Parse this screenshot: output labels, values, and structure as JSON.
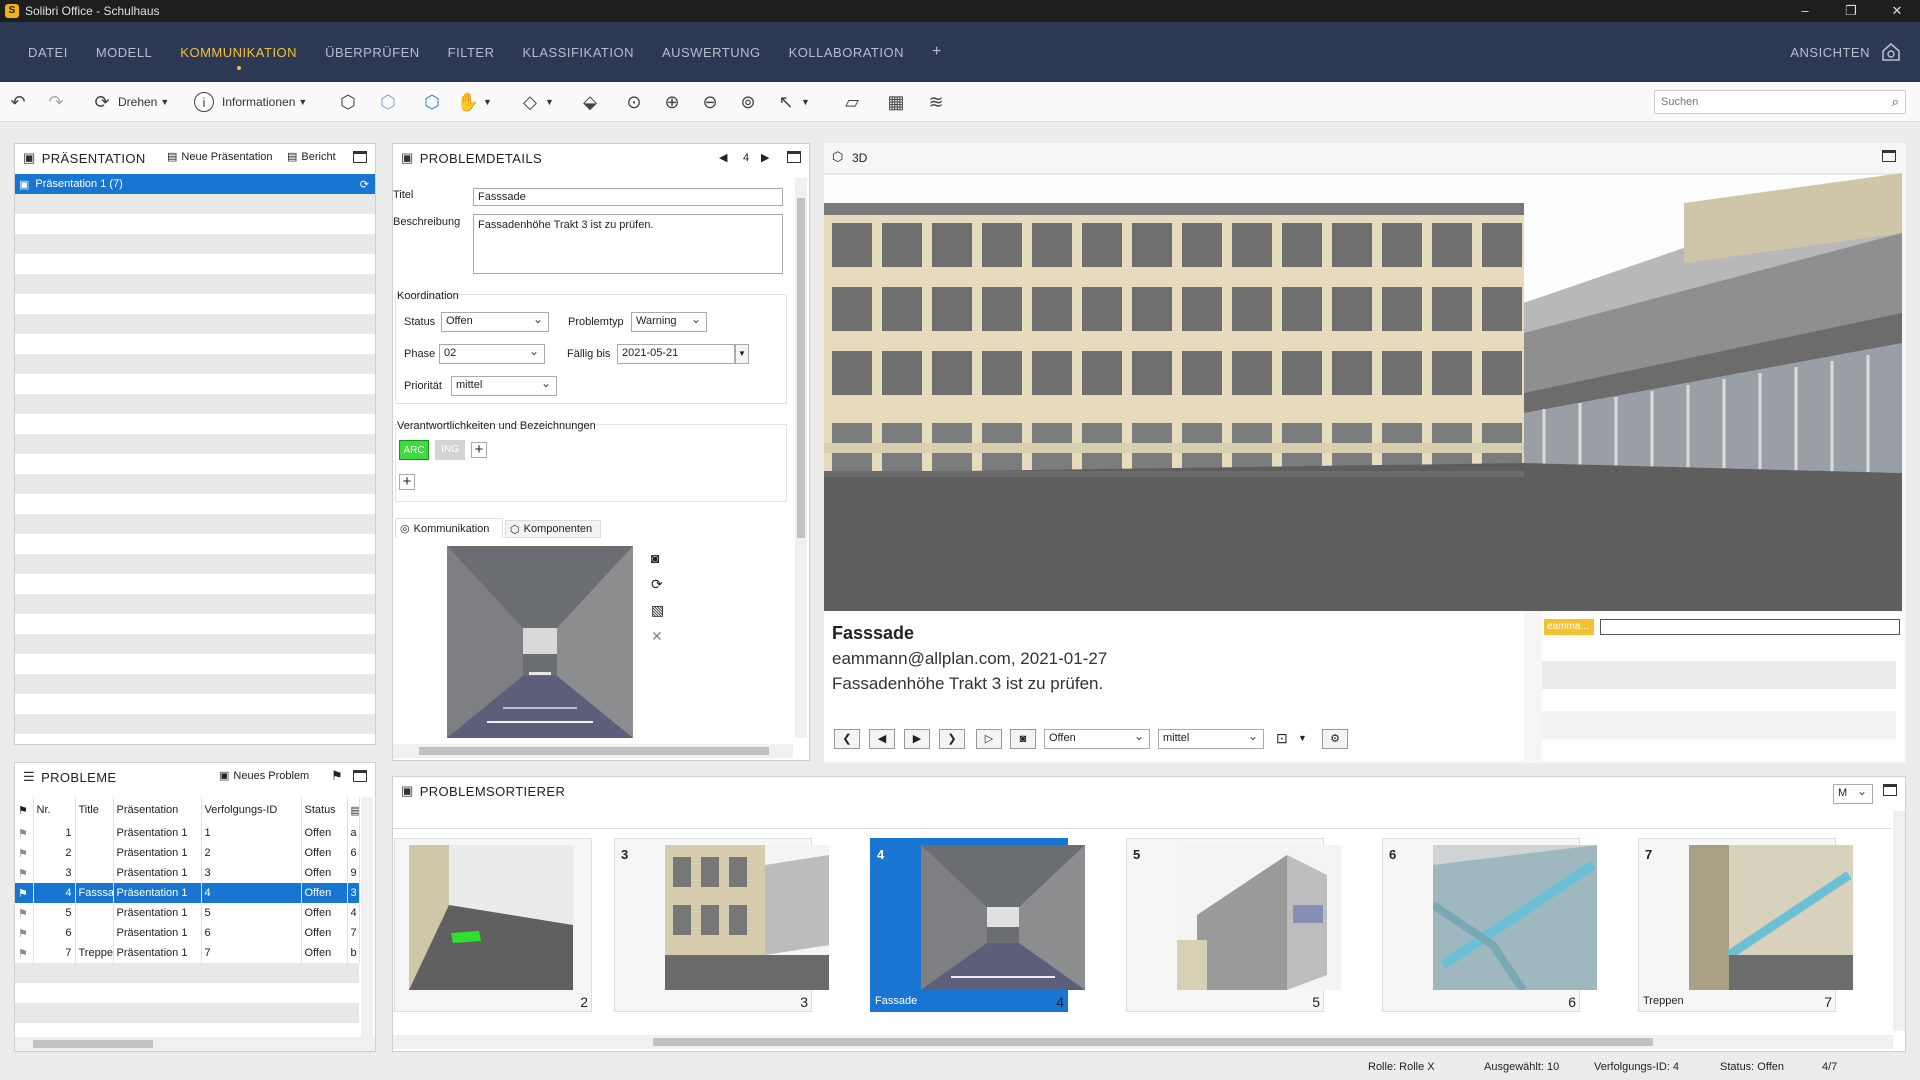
{
  "window": {
    "title": "Solibri Office - Schulhaus",
    "app_icon_letter": "S",
    "minimize": "–",
    "maximize": "❐",
    "close": "✕"
  },
  "menu": {
    "items": [
      "DATEI",
      "MODELL",
      "KOMMUNIKATION",
      "ÜBERPRÜFEN",
      "FILTER",
      "KLASSIFIKATION",
      "AUSWERTUNG",
      "KOLLABORATION",
      "+"
    ],
    "active_index": 2,
    "right_label": "ANSICHTEN"
  },
  "toolbar": {
    "rotate_label": "Drehen",
    "info_label": "Informationen",
    "search_placeholder": "Suchen"
  },
  "presentation_panel": {
    "title": "PRÄSENTATION",
    "new_label": "Neue Präsentation",
    "report_label": "Bericht",
    "selected_item": "Präsentation 1 (7)"
  },
  "details_panel": {
    "title": "PROBLEMDETAILS",
    "index": "4",
    "title_label": "Titel",
    "title_value": "Fasssade",
    "desc_label": "Beschreibung",
    "desc_value": "Fassadenhöhe Trakt 3 ist zu prüfen.",
    "coord_label": "Koordination",
    "status_label": "Status",
    "status_value": "Offen",
    "type_label": "Problemtyp",
    "type_value": "Warning",
    "phase_label": "Phase",
    "phase_value": "02",
    "due_label": "Fällig bis",
    "due_value": "2021-05-21",
    "priority_label": "Priorität",
    "priority_value": "mittel",
    "resp_label": "Verantwortlichkeiten und Bezeichnungen",
    "tag_arc": "ARC",
    "tag_ing": "ING",
    "tab_comm": "Kommunikation",
    "tab_comp": "Komponenten"
  },
  "view3d": {
    "title": "3D",
    "issue_title": "Fasssade",
    "issue_meta": "eammann@allplan.com, 2021-01-27",
    "issue_desc": "Fassadenhöhe Trakt 3 ist zu prüfen.",
    "status_select": "Offen",
    "priority_select": "mittel",
    "user_tag": "eamma..."
  },
  "problems_panel": {
    "title": "PROBLEME",
    "new_label": "Neues Problem",
    "columns": [
      "Nr.",
      "Title",
      "Präsentation",
      "Verfolgungs-ID",
      "Status"
    ],
    "rows": [
      {
        "nr": "1",
        "title": "",
        "pres": "Präsentation 1",
        "id": "1",
        "status": "Offen",
        "extra": "a"
      },
      {
        "nr": "2",
        "title": "",
        "pres": "Präsentation 1",
        "id": "2",
        "status": "Offen",
        "extra": "6"
      },
      {
        "nr": "3",
        "title": "",
        "pres": "Präsentation 1",
        "id": "3",
        "status": "Offen",
        "extra": "9"
      },
      {
        "nr": "4",
        "title": "Fasssad",
        "pres": "Präsentation 1",
        "id": "4",
        "status": "Offen",
        "extra": "3"
      },
      {
        "nr": "5",
        "title": "",
        "pres": "Präsentation 1",
        "id": "5",
        "status": "Offen",
        "extra": "4"
      },
      {
        "nr": "6",
        "title": "",
        "pres": "Präsentation 1",
        "id": "6",
        "status": "Offen",
        "extra": "7"
      },
      {
        "nr": "7",
        "title": "Treppe",
        "pres": "Präsentation 1",
        "id": "7",
        "status": "Offen",
        "extra": "b"
      }
    ],
    "selected_row": 3
  },
  "sorter_panel": {
    "title": "PROBLEMSORTIERER",
    "size_select": "M",
    "thumbs": [
      {
        "num": "",
        "inum": "2",
        "caption": ""
      },
      {
        "num": "3",
        "inum": "3",
        "caption": ""
      },
      {
        "num": "4",
        "inum": "4",
        "caption": "Fassade"
      },
      {
        "num": "5",
        "inum": "5",
        "caption": ""
      },
      {
        "num": "6",
        "inum": "6",
        "caption": ""
      },
      {
        "num": "7",
        "inum": "7",
        "caption": "Treppen"
      }
    ]
  },
  "statusbar": {
    "role": "Rolle: Rolle X",
    "selected": "Ausgewählt: 10",
    "tracking": "Verfolgungs-ID: 4",
    "status": "Status: Offen",
    "page": "4/7"
  },
  "colors": {
    "menubar": "#2d3954",
    "accent": "#f2c230",
    "selection": "#1875d1",
    "tag_arc": "#3ddc3d",
    "facade": "#e6dcbd"
  }
}
